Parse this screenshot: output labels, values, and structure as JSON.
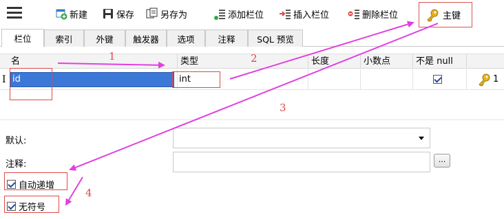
{
  "toolbar": {
    "new_label": "新建",
    "save_label": "保存",
    "save_as_label": "另存为",
    "add_field_label": "添加栏位",
    "insert_field_label": "插入栏位",
    "delete_field_label": "删除栏位",
    "primary_key_label": "主键"
  },
  "tabs": [
    "栏位",
    "索引",
    "外键",
    "触发器",
    "选项",
    "注释",
    "SQL 预览"
  ],
  "grid": {
    "columns": [
      "名",
      "类型",
      "长度",
      "小数点",
      "不是 null",
      ""
    ],
    "rows": [
      {
        "name": "id",
        "type": "int",
        "length": "",
        "decimals": "",
        "not_null": true,
        "key_index": "1"
      }
    ]
  },
  "form": {
    "default_label": "默认:",
    "default_value": "",
    "comment_label": "注释:",
    "comment_value": "",
    "dots_label": "...",
    "auto_increment_label": "自动递增",
    "auto_increment_checked": true,
    "unsigned_label": "无符号",
    "unsigned_checked": true
  },
  "annotations": [
    "1",
    "2",
    "3",
    "4"
  ],
  "colors": {
    "annotation_arrow": "#e040e0",
    "annotation_box": "#e04848",
    "selection": "#3b78d8"
  }
}
